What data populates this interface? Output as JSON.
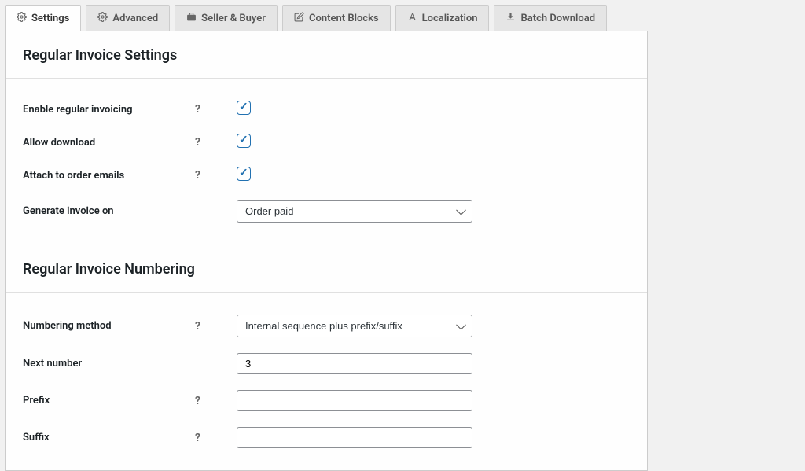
{
  "tabs": [
    {
      "label": "Settings",
      "icon": "settings"
    },
    {
      "label": "Advanced",
      "icon": "settings"
    },
    {
      "label": "Seller & Buyer",
      "icon": "briefcase"
    },
    {
      "label": "Content Blocks",
      "icon": "edit"
    },
    {
      "label": "Localization",
      "icon": "font"
    },
    {
      "label": "Batch Download",
      "icon": "download"
    }
  ],
  "sections": {
    "invoice_settings": {
      "title": "Regular Invoice Settings",
      "fields": {
        "enable_label": "Enable regular invoicing",
        "allow_download_label": "Allow download",
        "attach_emails_label": "Attach to order emails",
        "generate_on_label": "Generate invoice on",
        "generate_on_value": "Order paid"
      }
    },
    "invoice_numbering": {
      "title": "Regular Invoice Numbering",
      "fields": {
        "numbering_method_label": "Numbering method",
        "numbering_method_value": "Internal sequence plus prefix/suffix",
        "next_number_label": "Next number",
        "next_number_value": "3",
        "prefix_label": "Prefix",
        "prefix_value": "",
        "suffix_label": "Suffix",
        "suffix_value": ""
      }
    }
  }
}
